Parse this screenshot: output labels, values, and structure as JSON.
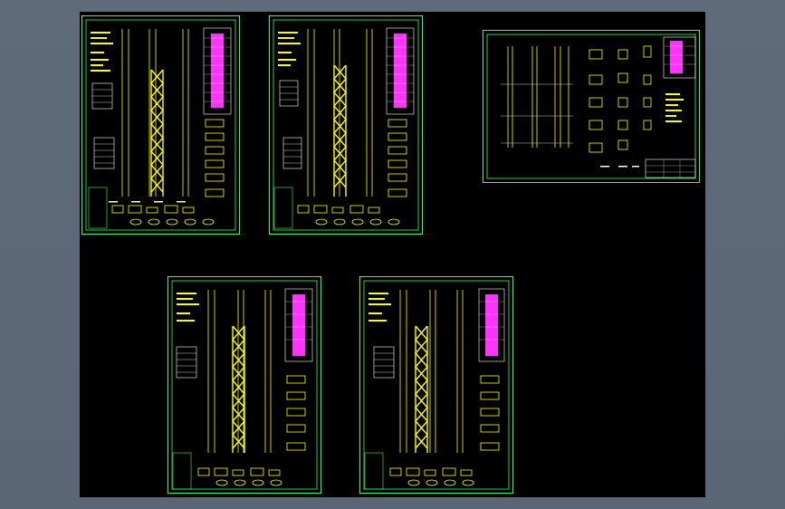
{
  "app": {
    "view": "cad-model-space-preview",
    "background_color": "#000000",
    "workspace_color": "#5d6a7a"
  },
  "colors": {
    "border": "#33ff66",
    "structure": "#ffff00",
    "annotation": "#ffffff",
    "table_fill": "#ff33ff",
    "cyan": "#33ffff"
  },
  "sheets": [
    {
      "id": "sheet-1",
      "orientation": "portrait",
      "variant": "tower"
    },
    {
      "id": "sheet-2",
      "orientation": "portrait",
      "variant": "tower"
    },
    {
      "id": "sheet-3",
      "orientation": "landscape",
      "variant": "details"
    },
    {
      "id": "sheet-4",
      "orientation": "portrait",
      "variant": "tower"
    },
    {
      "id": "sheet-5",
      "orientation": "portrait",
      "variant": "tower"
    }
  ]
}
